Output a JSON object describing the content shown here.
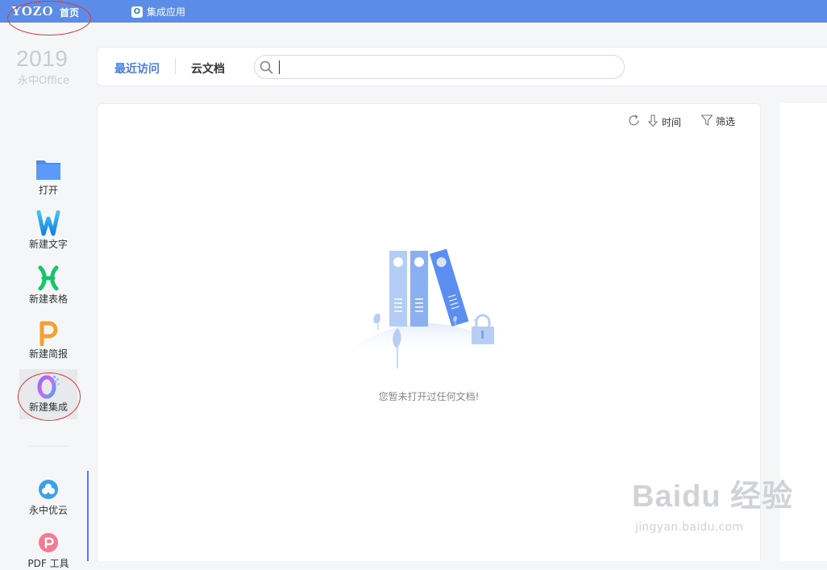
{
  "topbar": {
    "logo": "YOZO",
    "home_tab": "首页",
    "apps_tab": "集成应用",
    "apps_icon_letter": "O",
    "bg_color": "#5b8ce8"
  },
  "brand": {
    "year": "2019",
    "name": "永中Office"
  },
  "sidebar": {
    "items": [
      {
        "label": "打开",
        "icon": "folder-icon"
      },
      {
        "label": "新建文字",
        "icon": "writer-w-icon"
      },
      {
        "label": "新建表格",
        "icon": "sheet-x-icon"
      },
      {
        "label": "新建简报",
        "icon": "presentation-p-icon"
      },
      {
        "label": "新建集成",
        "icon": "integrated-o-icon"
      }
    ],
    "bottom": [
      {
        "label": "永中优云",
        "icon": "cloud-icon"
      },
      {
        "label": "PDF 工具",
        "icon": "pdf-icon"
      }
    ]
  },
  "nav": {
    "recent_tab": "最近访问",
    "cloud_tab": "云文档",
    "search_value": "",
    "accent": "#4a7ee0"
  },
  "panel": {
    "time_label": "时间",
    "filter_label": "筛选",
    "empty_text": "您暂未打开过任何文档!"
  },
  "watermark": {
    "brand": "Baidu 经验",
    "url": "jingyan.baidu.com"
  }
}
